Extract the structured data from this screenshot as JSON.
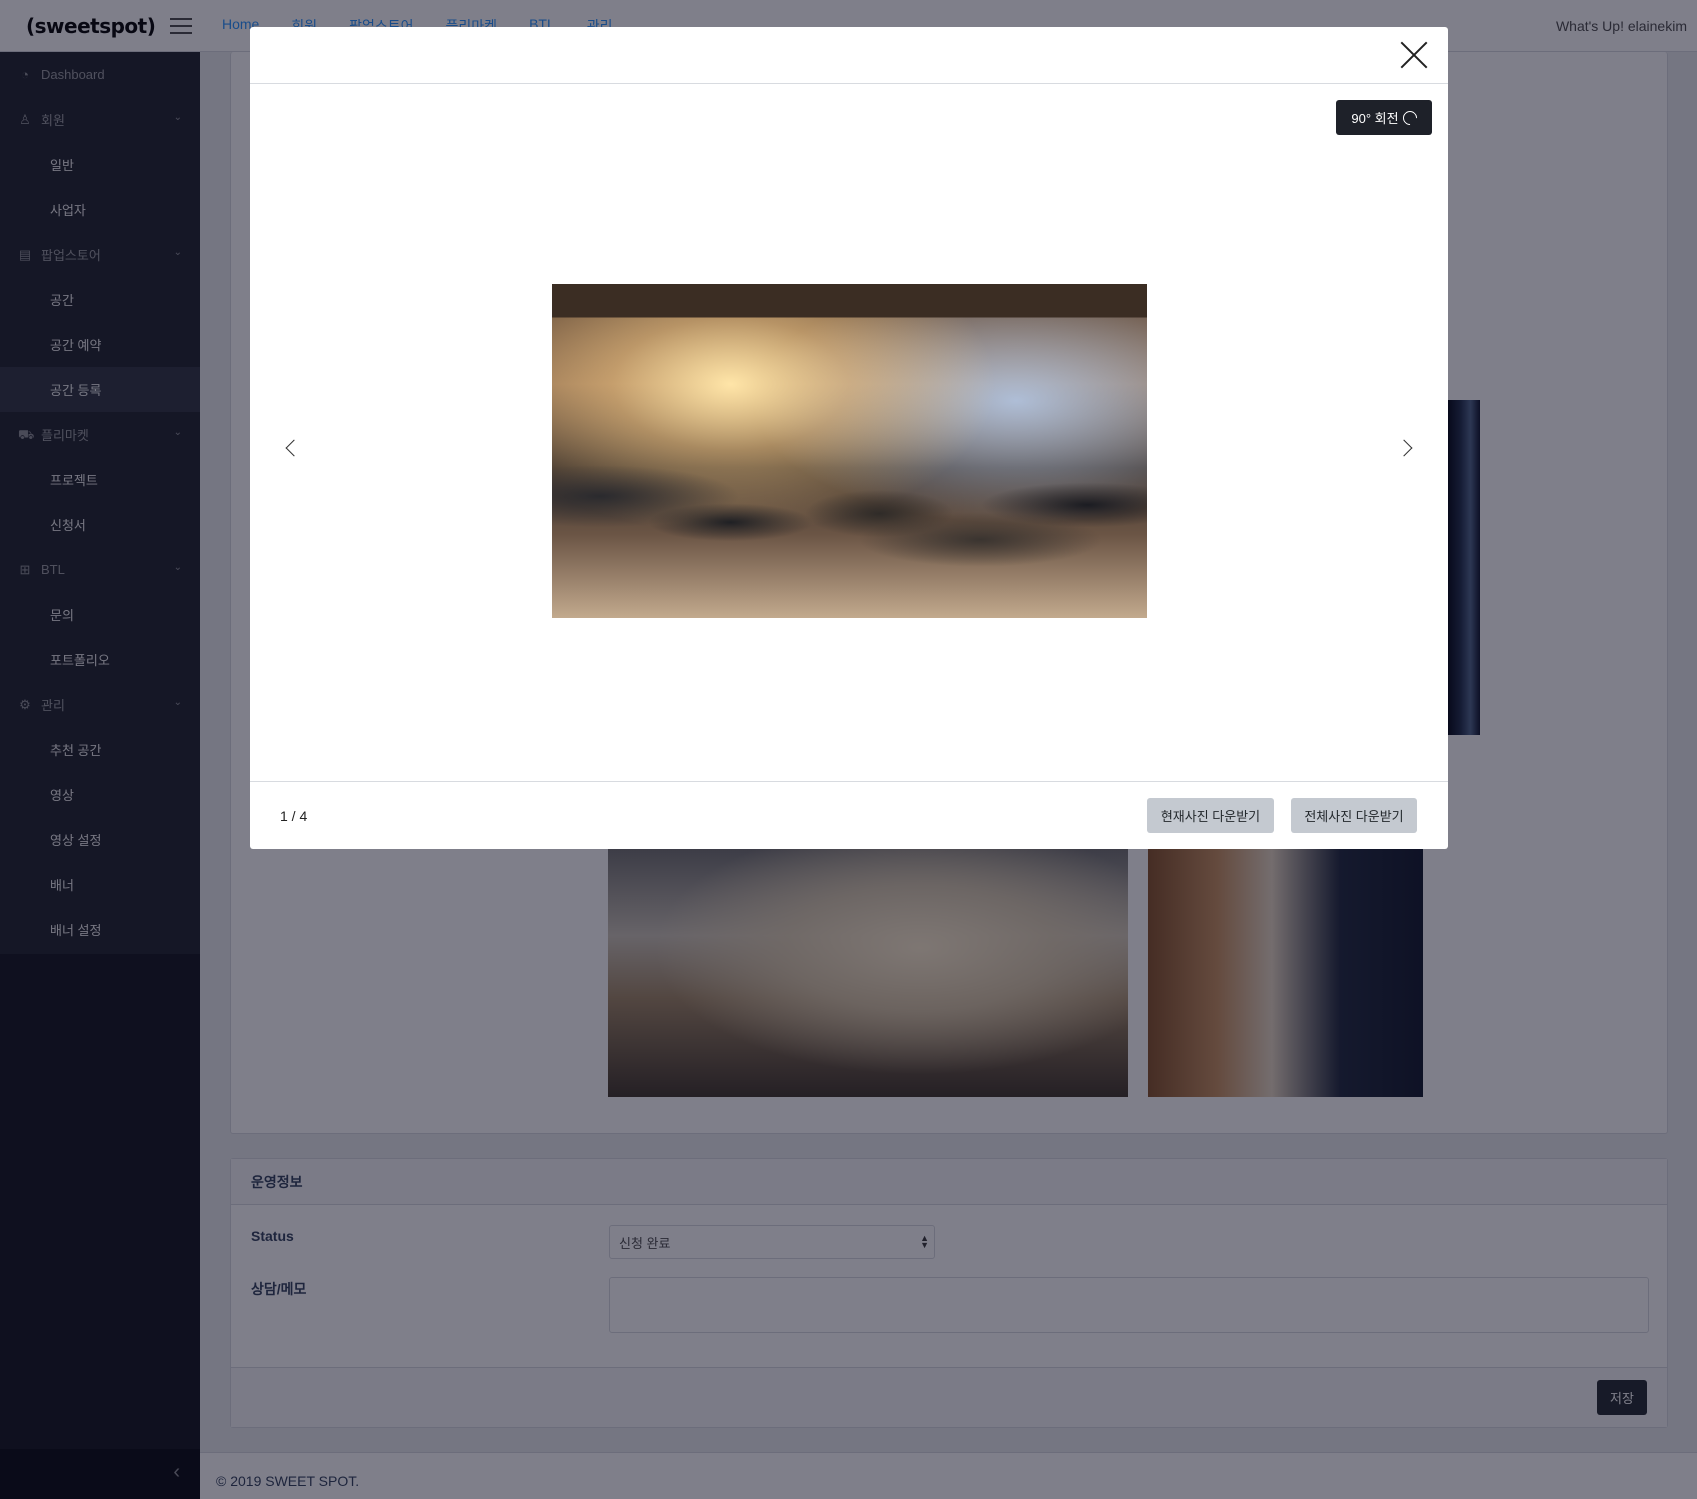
{
  "header": {
    "brand": "(sweetspot)",
    "nav": [
      "Home",
      "회원",
      "팝업스토어",
      "플리마켓",
      "BTL",
      "관리"
    ],
    "greeting": "What's Up! elainekim"
  },
  "sidebar": {
    "dashboard": "Dashboard",
    "groups": [
      {
        "label": "회원",
        "icon": "user-icon",
        "children": [
          "일반",
          "사업자"
        ]
      },
      {
        "label": "팝업스토어",
        "icon": "building-icon",
        "children": [
          "공간",
          "공간 예약",
          "공간 등록"
        ]
      },
      {
        "label": "플리마켓",
        "icon": "cart-icon",
        "children": [
          "프로젝트",
          "신청서"
        ]
      },
      {
        "label": "BTL",
        "icon": "grid-icon",
        "children": [
          "문의",
          "포트폴리오"
        ]
      },
      {
        "label": "관리",
        "icon": "gear-icon",
        "children": [
          "추천 공간",
          "영상",
          "영상 설정",
          "배너",
          "배너 설정"
        ]
      }
    ],
    "active_item": "공간 등록"
  },
  "operations": {
    "title": "운영정보",
    "status_label": "Status",
    "status_value": "신청 완료",
    "memo_label": "상담/메모",
    "memo_value": "",
    "save_label": "저장"
  },
  "footer": {
    "copyright": "© 2019 SWEET SPOT."
  },
  "modal": {
    "rotate_label": "90° 회전",
    "pager": "1 / 4",
    "download_current": "현재사진 다운받기",
    "download_all": "전체사진 다운받기"
  }
}
